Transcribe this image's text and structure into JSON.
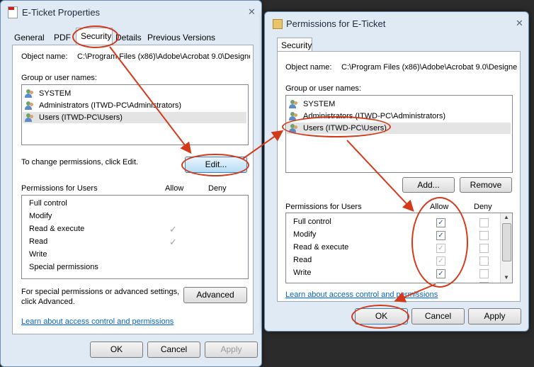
{
  "left": {
    "title": "E-Ticket Properties",
    "close": "✕",
    "tabs": [
      "General",
      "PDF",
      "Security",
      "Details",
      "Previous Versions"
    ],
    "object_label": "Object name:",
    "object_value": "C:\\Program Files (x86)\\Adobe\\Acrobat 9.0\\Designe",
    "group_label": "Group or user names:",
    "users": [
      "SYSTEM",
      "Administrators (ITWD-PC\\Administrators)",
      "Users (ITWD-PC\\Users)"
    ],
    "change_text": "To change permissions, click Edit.",
    "edit": "Edit...",
    "perm_label": "Permissions for Users",
    "allow": "Allow",
    "deny": "Deny",
    "perms": [
      "Full control",
      "Modify",
      "Read & execute",
      "Read",
      "Write",
      "Special permissions"
    ],
    "special_text_1": "For special permissions or advanced settings,",
    "special_text_2": "click Advanced.",
    "advanced": "Advanced",
    "link": "Learn about access control and permissions",
    "ok": "OK",
    "cancel": "Cancel",
    "apply": "Apply"
  },
  "right": {
    "title": "Permissions for E-Ticket",
    "close": "✕",
    "tab": "Security",
    "object_label": "Object name:",
    "object_value": "C:\\Program Files (x86)\\Adobe\\Acrobat 9.0\\Designe",
    "group_label": "Group or user names:",
    "users": [
      "SYSTEM",
      "Administrators (ITWD-PC\\Administrators)",
      "Users (ITWD-PC\\Users)"
    ],
    "add": "Add...",
    "remove": "Remove",
    "perm_label": "Permissions for Users",
    "allow": "Allow",
    "deny": "Deny",
    "perms": [
      "Full control",
      "Modify",
      "Read & execute",
      "Read",
      "Write"
    ],
    "link": "Learn about access control and permissions",
    "ok": "OK",
    "cancel": "Cancel",
    "apply": "Apply"
  },
  "annotation_color": "#d23a1a"
}
